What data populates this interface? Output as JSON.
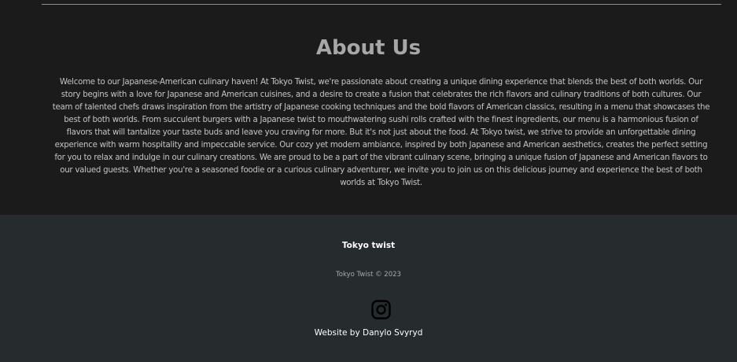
{
  "about": {
    "title": "About Us",
    "text": "Welcome to our Japanese-American culinary haven! At Tokyo Twist, we're passionate about creating a unique dining experience that blends the best of both worlds. Our story begins with a love for Japanese and American cuisines, and a desire to create a fusion that celebrates the rich flavors and culinary traditions of both cultures. Our team of talented chefs draws inspiration from the artistry of Japanese cooking techniques and the bold flavors of American classics, resulting in a menu that showcases the best of both worlds. From succulent burgers with a Japanese twist to mouthwatering sushi rolls crafted with the finest ingredients, our menu is a harmonious fusion of flavors that will tantalize your taste buds and leave you craving for more. But it's not just about the food. At Tokyo twist, we strive to provide an unforgettable dining experience with warm hospitality and impeccable service. Our cozy yet modern ambiance, inspired by both Japanese and American aesthetics, creates the perfect setting for you to relax and indulge in our culinary creations. We are proud to be a part of the vibrant culinary scene, bringing a unique fusion of Japanese and American flavors to our valued guests. Whether you're a seasoned foodie or a curious culinary adventurer, we invite you to join us on this delicious journey and experience the best of both worlds at Tokyo Twist."
  },
  "footer": {
    "brand": "Tokyo twist",
    "copyright": "Tokyo Twist © 2023",
    "social_icon": "instagram-icon",
    "credit": "Website by Danylo Svyryd"
  },
  "colors": {
    "page_background": "#1b1b1b",
    "footer_background": "#262b2e",
    "title": "#a7a7a7",
    "body_text": "#c4c4c4",
    "footer_text": "#ffffff"
  }
}
